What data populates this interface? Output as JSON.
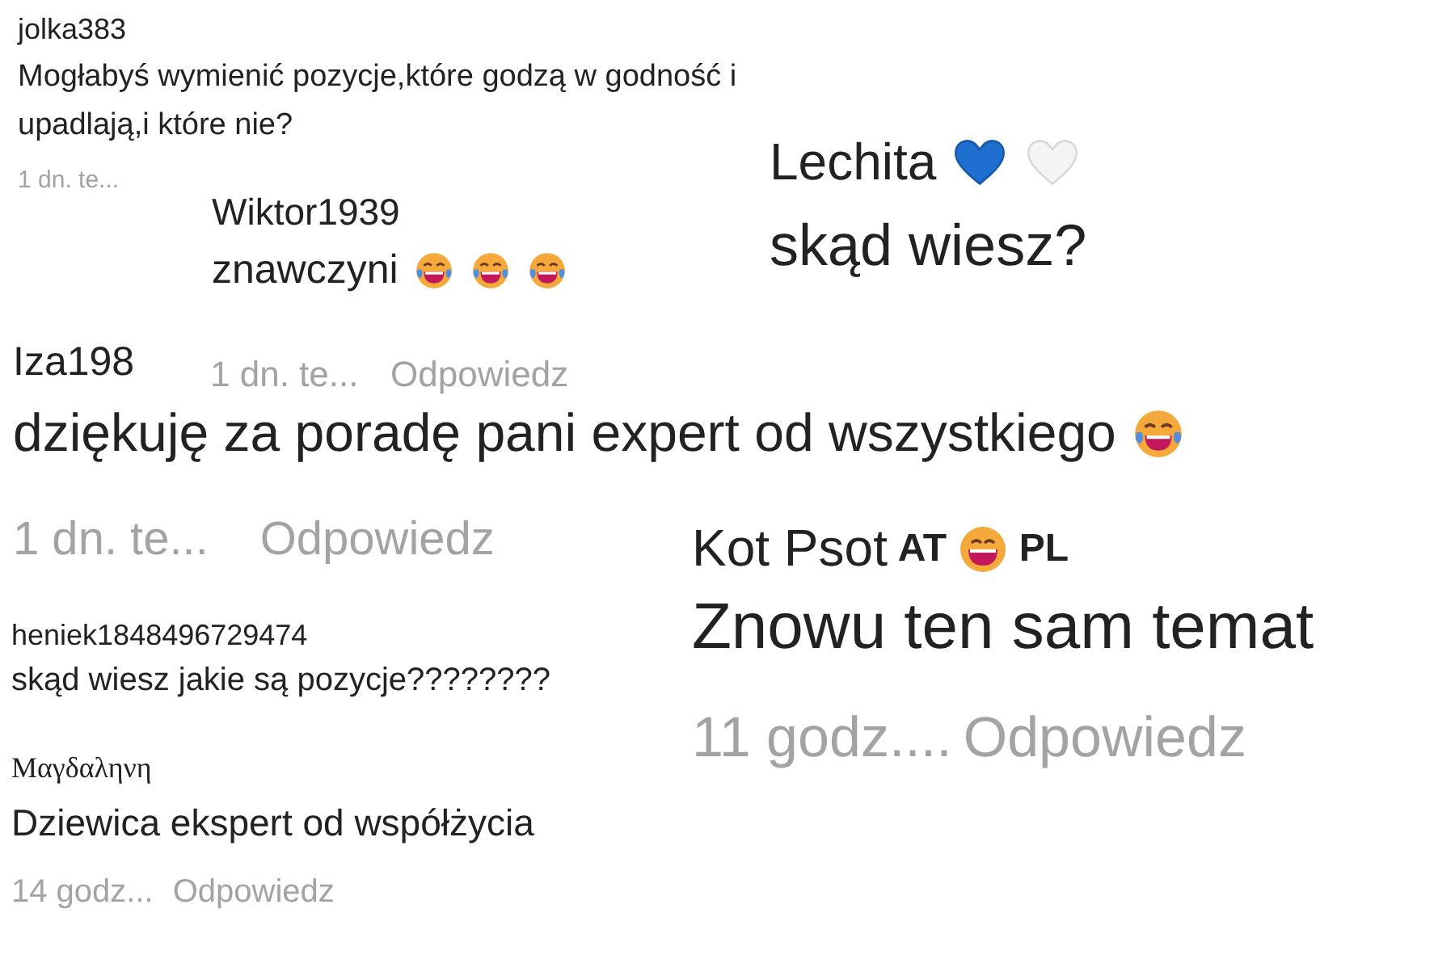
{
  "fragments": [
    {
      "username": "jolka383",
      "text": "Mogłabyś wymienić pozycje,które godzą w godność i upadlają,i które nie?",
      "time": "1 dn. te..."
    },
    {
      "username": "Wiktor1939",
      "text": "znawczyni"
    },
    {
      "username": "Lechita",
      "text": "skąd wiesz?"
    },
    {
      "time": "1 dn. te...",
      "reply": "Odpowiedz"
    },
    {
      "username": "Iza198",
      "text": "dziękuję za poradę pani expert od wszystkiego"
    },
    {
      "time": "1 dn. te...",
      "reply": "Odpowiedz"
    },
    {
      "username": "heniek1848496729474",
      "text": "skąd wiesz jakie są pozycje????????"
    },
    {
      "username": "Μαγδαληνη",
      "text": "Dziewica ekspert od współżycia",
      "time": "14 godz...",
      "reply": "Odpowiedz"
    },
    {
      "username": "Kot Psot",
      "flair": [
        "AT",
        "PL"
      ],
      "text": "Znowu ten sam temat",
      "time": "11 godz....",
      "reply": "Odpowiedz"
    }
  ]
}
